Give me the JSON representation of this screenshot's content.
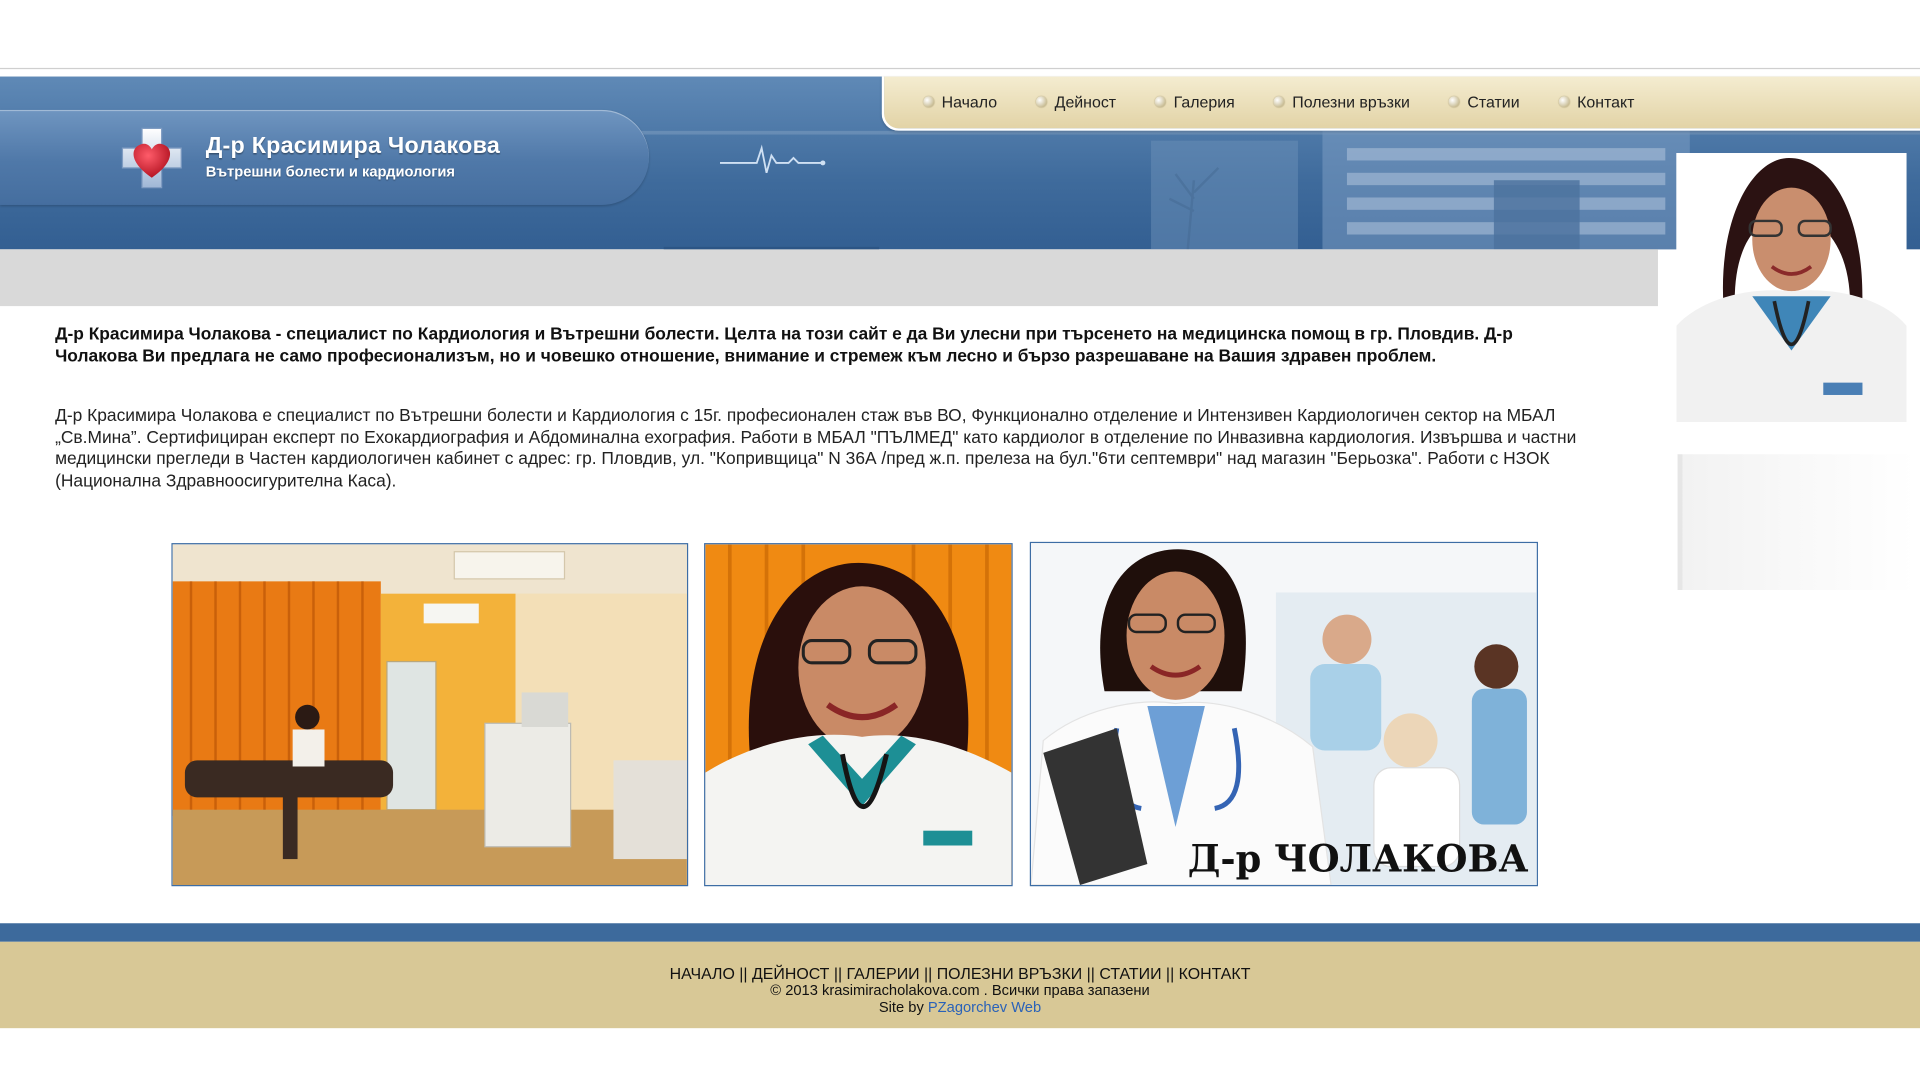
{
  "header": {
    "title": "Д-р Красимира Чолакова",
    "subtitle": "Вътрешни болести и кардиология"
  },
  "nav": {
    "items": [
      {
        "label": "Начало"
      },
      {
        "label": "Дейност"
      },
      {
        "label": "Галерия"
      },
      {
        "label": "Полезни връзки"
      },
      {
        "label": "Статии"
      },
      {
        "label": "Контакт"
      }
    ]
  },
  "content": {
    "intro_bold": "Д-р Красимира Чолакова - специалист по Кардиология и Вътрешни болести. Целта на този сайт е да Ви улесни при търсенето на медицинска помощ в гр. Пловдив. Д-р Чолакова Ви предлага не само професионализъм, но и човешко отношение, внимание и стремеж към лесно и бързо разрешаване на Вашия здравен проблем.",
    "intro_text": "Д-р Красимира Чолакова е специалист по Вътрешни болести и Кардиология с 15г. професионален стаж във ВО, Функционално отделение и Интензивен Кардиологичен сектор на МБАЛ „Св.Мина”. Сертифициран експерт по Ехокардиография и Абдоминална ехография. Работи в МБАЛ \"ПЪЛМЕД\" като кардиолог в отделение по Инвазивна кардиология. Извършва и частни медицински прегледи в Частен кардиологичен кабинет с адрес: гр. Пловдив, ул. \"Копривщица\" N 36А /пред ж.п. прелеза на бул.\"6ти септември\" над магазин \"Берьозка\". Работи с НЗОК (Национална Здравноосигурителна Каса).",
    "photo3_caption": "Д-р ЧОЛАКОВА"
  },
  "footer": {
    "links": [
      "НАЧАЛО",
      "ДЕЙНОСТ",
      "ГАЛЕРИИ",
      "ПОЛЕЗНИ ВРЪЗКИ",
      "СТАТИИ",
      "КОНТАКТ"
    ],
    "separator": " || ",
    "copyright": "© 2013 krasimiracholakova.com . Всички права запазени",
    "credit_prefix": "Site by ",
    "credit_link": "PZagorchev Web"
  },
  "colors": {
    "header_blue": "#3f6b9c",
    "nav_beige": "#e2d3a6",
    "footer_beige": "#d8c896",
    "footer_bar": "#3d6a9c",
    "link_blue": "#2a62b8",
    "logo_heart": "#c8102e"
  },
  "icons": {
    "logo": "medical-cross-heart-icon",
    "ecg": "heartbeat-line-icon",
    "nav_bullet": "round-bullet-icon"
  }
}
